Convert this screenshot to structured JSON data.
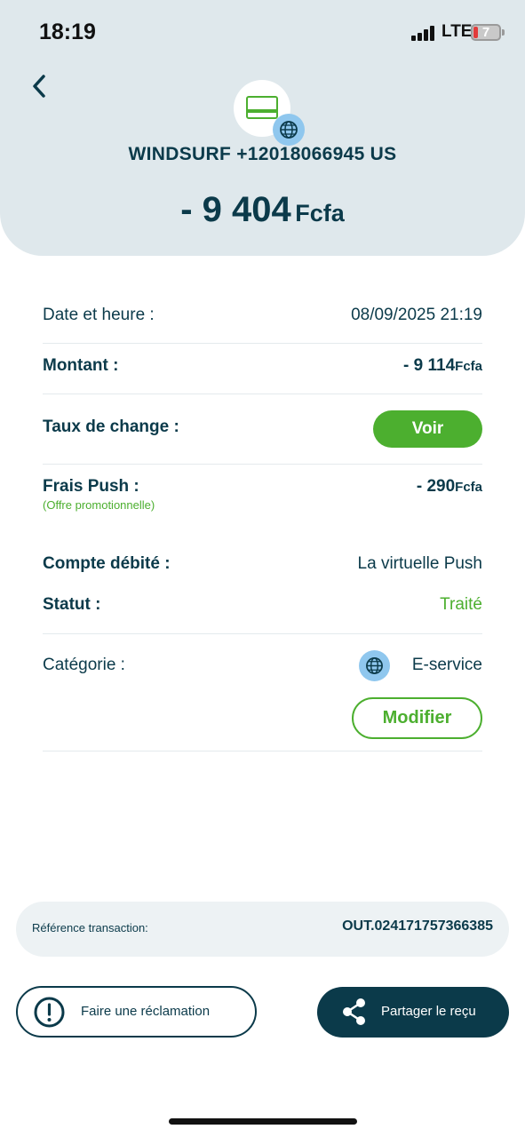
{
  "status_bar": {
    "time": "18:19",
    "network": "LTE",
    "battery": "7"
  },
  "header": {
    "merchant": "WINDSURF +12018066945 US",
    "amount": "- 9 404",
    "currency": "Fcfa"
  },
  "details": {
    "date": {
      "label": "Date et heure :",
      "value": "08/09/2025 21:19"
    },
    "montant": {
      "label": "Montant :",
      "value": "- 9 114",
      "currency": "Fcfa"
    },
    "taux": {
      "label": "Taux de change :",
      "button": "Voir"
    },
    "frais": {
      "label": "Frais Push :",
      "note": "(Offre promotionnelle)",
      "value": "- 290",
      "currency": "Fcfa"
    },
    "compte": {
      "label": "Compte débité :",
      "value": "La virtuelle Push"
    },
    "statut": {
      "label": "Statut :",
      "value": "Traité"
    },
    "categorie": {
      "label": "Catégorie :",
      "value": "E-service",
      "button": "Modifier"
    }
  },
  "reference": {
    "label": "Référence transaction:",
    "value": "OUT.024171757366385"
  },
  "actions": {
    "claim": "Faire une réclamation",
    "share": "Partager le reçu"
  },
  "icons": {
    "back": "chevron-left-icon",
    "card": "credit-card-icon",
    "globe": "globe-icon",
    "claim": "exclamation-circle-icon",
    "share": "share-icon"
  },
  "colors": {
    "primary": "#0b3a4a",
    "accent": "#4caf2f",
    "header_bg": "#dfe8ec",
    "globe_badge": "#8fc7ee"
  }
}
